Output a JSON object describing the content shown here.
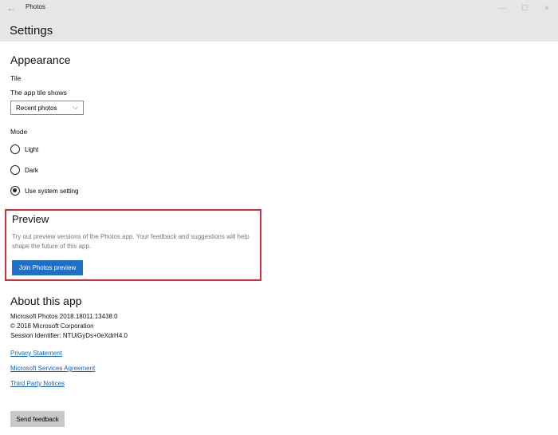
{
  "window": {
    "app_title": "Photos",
    "back_icon": "arrow-left-icon",
    "controls": [
      "minimize-icon",
      "maximize-icon",
      "close-icon"
    ]
  },
  "header": {
    "title": "Settings"
  },
  "appearance": {
    "heading": "Appearance",
    "tile_label": "Tile",
    "tile_shows_label": "The app tile shows",
    "tile_selected": "Recent photos",
    "mode_label": "Mode",
    "modes": [
      {
        "label": "Light",
        "selected": false
      },
      {
        "label": "Dark",
        "selected": false
      },
      {
        "label": "Use system setting",
        "selected": true
      }
    ]
  },
  "preview": {
    "heading": "Preview",
    "description": "Try out preview versions of the Photos app. Your feedback and suggestions will help shape the future of this app.",
    "join_label": "Join Photos preview",
    "highlight_color": "#d0313a",
    "button_color": "#1f6fc6"
  },
  "about": {
    "heading": "About this app",
    "version": "Microsoft Photos 2018.18011.13438.0",
    "copyright": "© 2018 Microsoft Corporation",
    "session": "Session Identifier: NTUiGyDs+0eXdrH4.0",
    "links": [
      "Privacy Statement",
      "Microsoft Services Agreement",
      "Third Party Notices"
    ]
  },
  "feedback": {
    "label": "Send feedback"
  },
  "colors": {
    "link": "#1461c2",
    "header_bg": "#e6e6e6"
  }
}
